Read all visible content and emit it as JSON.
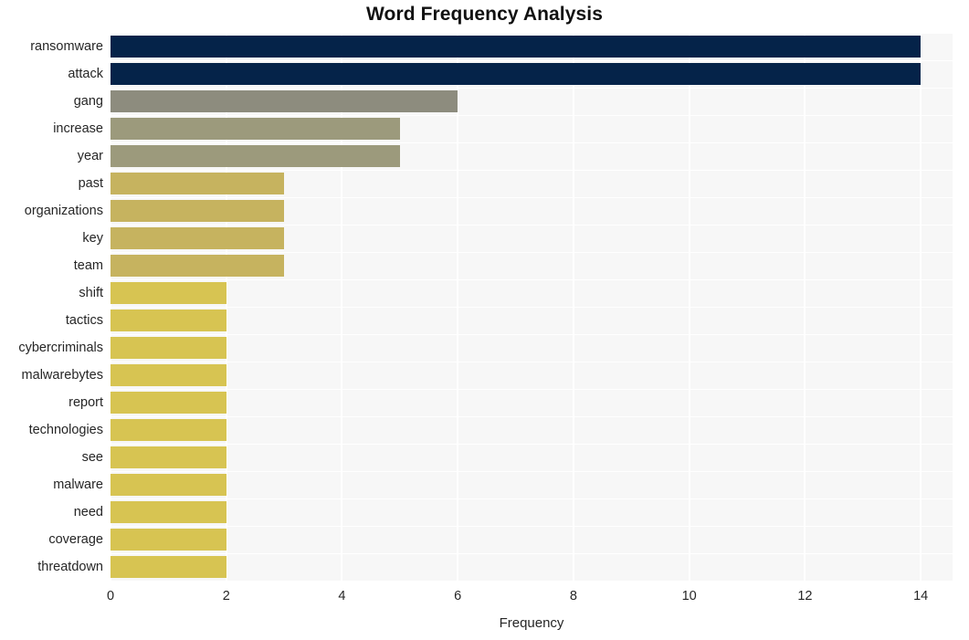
{
  "chart_data": {
    "type": "bar",
    "orientation": "horizontal",
    "title": "Word Frequency Analysis",
    "xlabel": "Frequency",
    "ylabel": "",
    "xlim": [
      0,
      14.55
    ],
    "xticks": [
      0,
      2,
      4,
      6,
      8,
      10,
      12,
      14
    ],
    "xtick_labels": [
      "0",
      "2",
      "4",
      "6",
      "8",
      "10",
      "12",
      "14"
    ],
    "grid": true,
    "grid_color": "#ffffff",
    "legend": null,
    "plot_background": "#f7f7f7",
    "figure_background": "#ffffff",
    "categories": [
      "ransomware",
      "attack",
      "gang",
      "increase",
      "year",
      "past",
      "organizations",
      "key",
      "team",
      "shift",
      "tactics",
      "cybercriminals",
      "malwarebytes",
      "report",
      "technologies",
      "see",
      "malware",
      "need",
      "coverage",
      "threatdown"
    ],
    "values": [
      14,
      14,
      6,
      5,
      5,
      3,
      3,
      3,
      3,
      2,
      2,
      2,
      2,
      2,
      2,
      2,
      2,
      2,
      2,
      2
    ],
    "colors": [
      "#052349",
      "#052349",
      "#8d8c7e",
      "#9c9a7c",
      "#9c9a7c",
      "#c6b35f",
      "#c6b35f",
      "#c6b35f",
      "#c6b35f",
      "#d7c452",
      "#d7c452",
      "#d7c452",
      "#d7c452",
      "#d7c452",
      "#d7c452",
      "#d7c452",
      "#d7c452",
      "#d7c452",
      "#d7c452",
      "#d7c452"
    ]
  }
}
